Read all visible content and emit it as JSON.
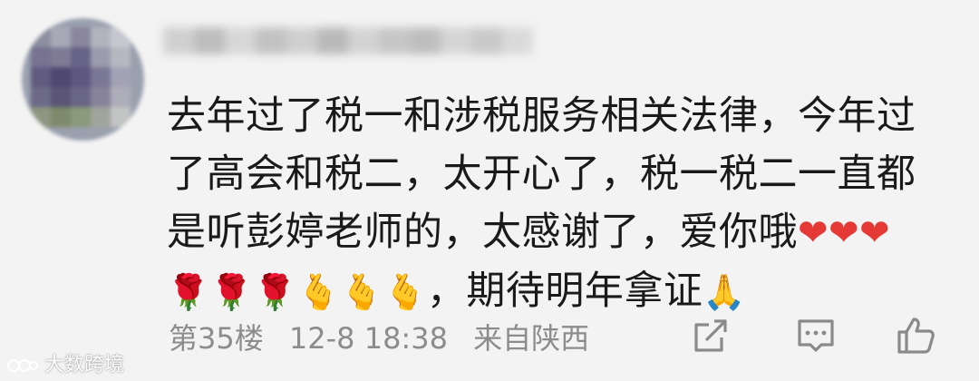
{
  "comment": {
    "lines": [
      "去年过了税一和涉税服务相关法律，今年过",
      "了高会和税二，太开心了，税一税二一直都",
      "是听彭婷老师的，太感谢了，爱你哦",
      "，期待明年拿证"
    ],
    "emojis": {
      "hearts": "❤❤❤",
      "roses": "🌹🌹🌹",
      "hands": "🫰🫰🫰",
      "pray": "🙏"
    }
  },
  "meta": {
    "floor": "第35楼",
    "datetime": "12-8 18:38",
    "location": "来自陕西"
  },
  "actions": {
    "share_icon": "share-icon",
    "reply_icon": "comment-icon",
    "like_icon": "thumbs-up-icon"
  },
  "watermark": {
    "text": "大数跨境"
  },
  "colors": {
    "background": "#f3f3f3",
    "text": "#1a1a1a",
    "meta_text": "#8c8c8c",
    "icon": "#8a8a8a",
    "heart": "#e53935"
  }
}
